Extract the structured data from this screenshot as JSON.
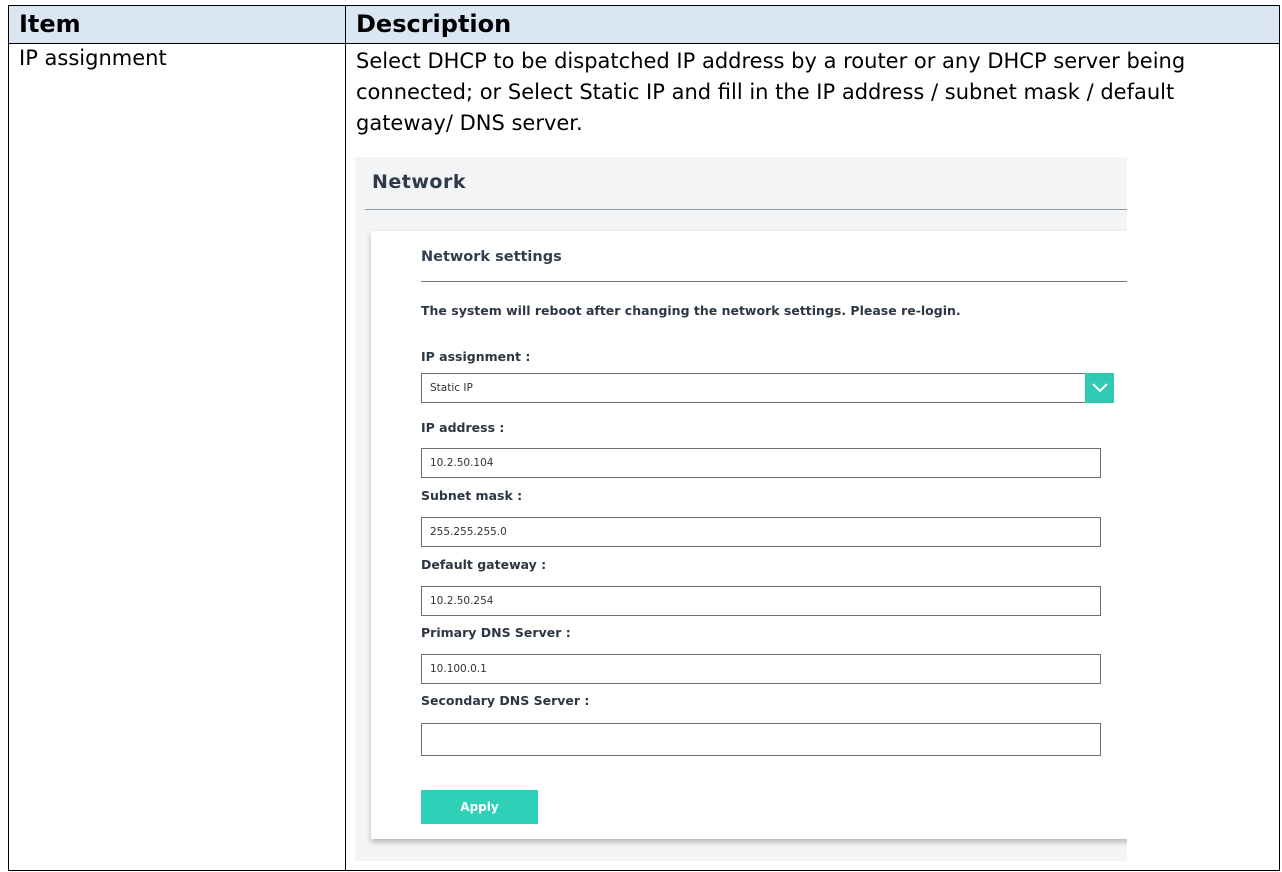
{
  "table": {
    "headers": [
      "Item",
      "Description"
    ],
    "row": {
      "item": "IP assignment",
      "description": "Select DHCP to be dispatched IP address by a router or any DHCP server being connected; or Select Static IP and fill in the IP address / subnet mask / default gateway/ DNS server."
    }
  },
  "screenshot": {
    "title": "Network",
    "card_title": "Network settings",
    "notice": "The system will reboot after changing the network settings. Please re-login.",
    "ip_assignment": {
      "label": "IP assignment :",
      "value": "Static IP",
      "icon": "chevron-down-icon"
    },
    "ip_address": {
      "label": "IP address :",
      "value": "10.2.50.104"
    },
    "subnet_mask": {
      "label": "Subnet mask :",
      "value": "255.255.255.0"
    },
    "default_gateway": {
      "label": "Default gateway :",
      "value": "10.2.50.254"
    },
    "primary_dns": {
      "label": "Primary DNS Server :",
      "value": "10.100.0.1"
    },
    "secondary_dns": {
      "label": "Secondary DNS Server :",
      "value": ""
    },
    "apply_label": "Apply",
    "accent_color": "#2fc9b4"
  }
}
